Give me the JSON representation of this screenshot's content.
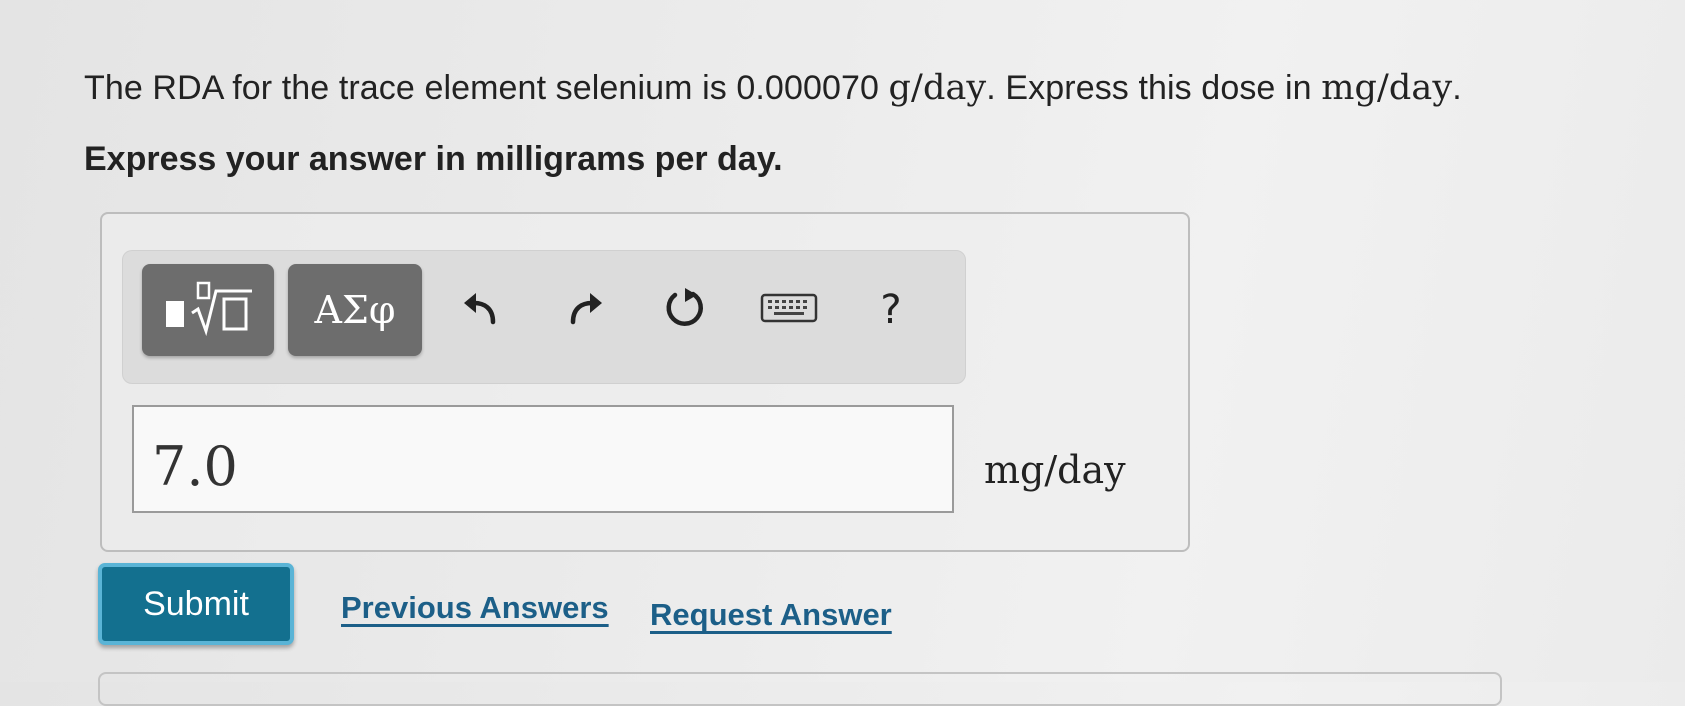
{
  "question": {
    "prefix": "The RDA for the trace element selenium is 0.000070",
    "unit_given": "g/day",
    "middle": ". Express this dose in",
    "unit_target": "mg/day",
    "suffix": "."
  },
  "instruction": "Express your answer in milligrams per day.",
  "toolbar": {
    "templates_icon": "fraction-radical-template-icon",
    "greek_label": "ΑΣφ",
    "undo_icon": "undo-icon",
    "redo_icon": "redo-icon",
    "reset_icon": "reset-icon",
    "keyboard_icon": "keyboard-icon",
    "help_label": "?"
  },
  "answer": {
    "value": "7.0",
    "unit": "mg/day"
  },
  "actions": {
    "submit_label": "Submit",
    "previous_answers_label": "Previous Answers",
    "request_answer_label": "Request Answer"
  },
  "colors": {
    "submit_bg": "#13708f",
    "submit_border": "#5ab4d6",
    "link": "#1c5f88",
    "toolbar_button": "#6d6d6d"
  }
}
